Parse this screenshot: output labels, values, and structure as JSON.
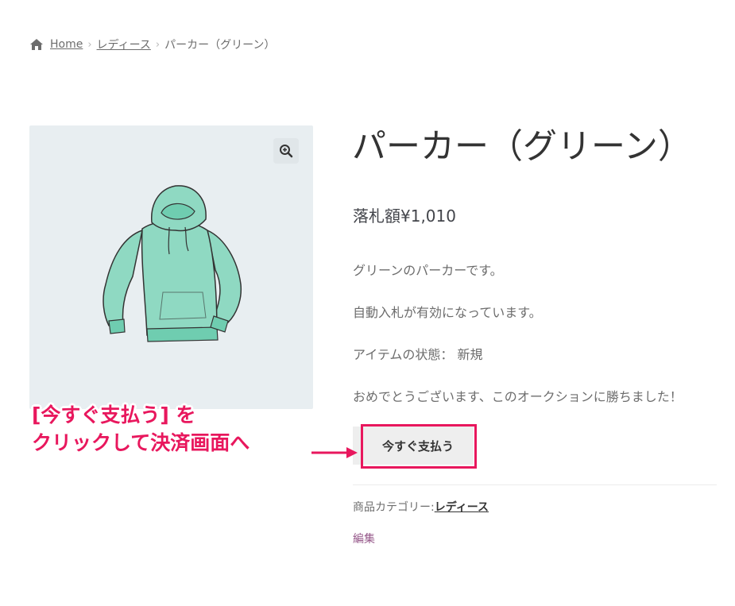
{
  "breadcrumb": {
    "home": "Home",
    "category": "レディース",
    "current": "パーカー（グリーン）"
  },
  "icons": {
    "home": "home-icon",
    "zoom": "zoom-in-icon",
    "arrow": "arrow-right-icon"
  },
  "product": {
    "title": "パーカー（グリーン）",
    "price": "落札額¥1,010",
    "description": [
      "グリーンのパーカーです。",
      "自動入札が有効になっています。",
      "アイテムの状態： 新規",
      "おめでとうございます、このオークションに勝ちました！"
    ],
    "buy_button": "今すぐ支払う",
    "category_label": "商品カテゴリー:",
    "category_link": "レディース",
    "edit_link": "編集"
  },
  "annotation": {
    "line1": "[今すぐ支払う] を",
    "line2": "クリックして決済画面へ"
  },
  "colors": {
    "accent": "#e8175d",
    "edit_link": "#96588a",
    "button_bg": "#eeeeee",
    "gallery_bg": "#e8eef1",
    "hoodie": "#8fd9c2"
  }
}
